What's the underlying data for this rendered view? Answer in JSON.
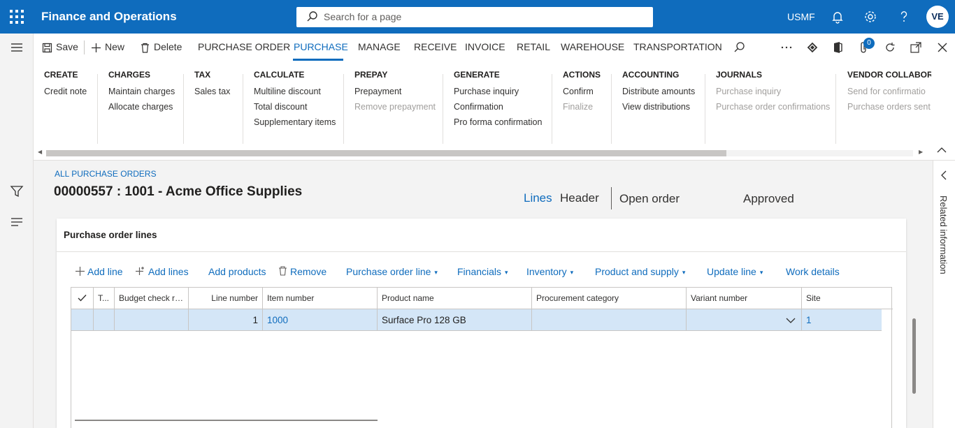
{
  "app": {
    "title": "Finance and Operations",
    "company": "USMF",
    "user_initials": "VE"
  },
  "search": {
    "placeholder": "Search for a page"
  },
  "actionbar": {
    "save": "Save",
    "new": "New",
    "delete": "Delete",
    "tabs": [
      "PURCHASE ORDER",
      "PURCHASE",
      "MANAGE",
      "RECEIVE",
      "INVOICE",
      "RETAIL",
      "WAREHOUSE",
      "TRANSPORTATION"
    ],
    "active_tab": "PURCHASE",
    "attachments_count": "0"
  },
  "groups": [
    {
      "title": "CREATE",
      "items": [
        {
          "label": "Credit note",
          "enabled": true
        }
      ]
    },
    {
      "title": "CHARGES",
      "items": [
        {
          "label": "Maintain charges",
          "enabled": true
        },
        {
          "label": "Allocate charges",
          "enabled": true
        }
      ]
    },
    {
      "title": "TAX",
      "items": [
        {
          "label": "Sales tax",
          "enabled": true
        }
      ]
    },
    {
      "title": "CALCULATE",
      "items": [
        {
          "label": "Multiline discount",
          "enabled": true
        },
        {
          "label": "Total discount",
          "enabled": true
        },
        {
          "label": "Supplementary items",
          "enabled": true
        }
      ]
    },
    {
      "title": "PREPAY",
      "items": [
        {
          "label": "Prepayment",
          "enabled": true
        },
        {
          "label": "Remove prepayment",
          "enabled": false
        }
      ]
    },
    {
      "title": "GENERATE",
      "items": [
        {
          "label": "Purchase inquiry",
          "enabled": true
        },
        {
          "label": "Confirmation",
          "enabled": true
        },
        {
          "label": "Pro forma confirmation",
          "enabled": true
        }
      ]
    },
    {
      "title": "ACTIONS",
      "items": [
        {
          "label": "Confirm",
          "enabled": true
        },
        {
          "label": "Finalize",
          "enabled": false
        }
      ]
    },
    {
      "title": "ACCOUNTING",
      "items": [
        {
          "label": "Distribute amounts",
          "enabled": true
        },
        {
          "label": "View distributions",
          "enabled": true
        }
      ]
    },
    {
      "title": "JOURNALS",
      "items": [
        {
          "label": "Purchase inquiry",
          "enabled": false
        },
        {
          "label": "Purchase order confirmations",
          "enabled": false
        }
      ]
    },
    {
      "title": "VENDOR COLLABORA",
      "items": [
        {
          "label": "Send for confirmatio",
          "enabled": false
        },
        {
          "label": "Purchase orders sent",
          "enabled": false
        }
      ]
    }
  ],
  "page": {
    "breadcrumb": "ALL PURCHASE ORDERS",
    "title": "00000557 : 1001 - Acme Office Supplies",
    "view_lines": "Lines",
    "view_header": "Header",
    "status_open": "Open order",
    "status_approval": "Approved"
  },
  "lines_card": {
    "title": "Purchase order lines",
    "buttons": [
      "Add line",
      "Add lines",
      "Add products",
      "Remove",
      "Purchase order line",
      "Financials",
      "Inventory",
      "Product and supply",
      "Update line",
      "Work details"
    ],
    "columns": [
      "T...",
      "Budget check re...",
      "Line number",
      "Item number",
      "Product name",
      "Procurement category",
      "Variant number",
      "Site"
    ],
    "rows": [
      {
        "type": "",
        "budget": "",
        "line_number": "1",
        "item_number": "1000",
        "product_name": "Surface Pro 128 GB",
        "category": "",
        "variant": "",
        "site": "1"
      }
    ]
  },
  "right_panel": {
    "label": "Related information"
  },
  "colors": {
    "brand": "#0f6cbd",
    "selected_row": "#d4e6f7"
  }
}
